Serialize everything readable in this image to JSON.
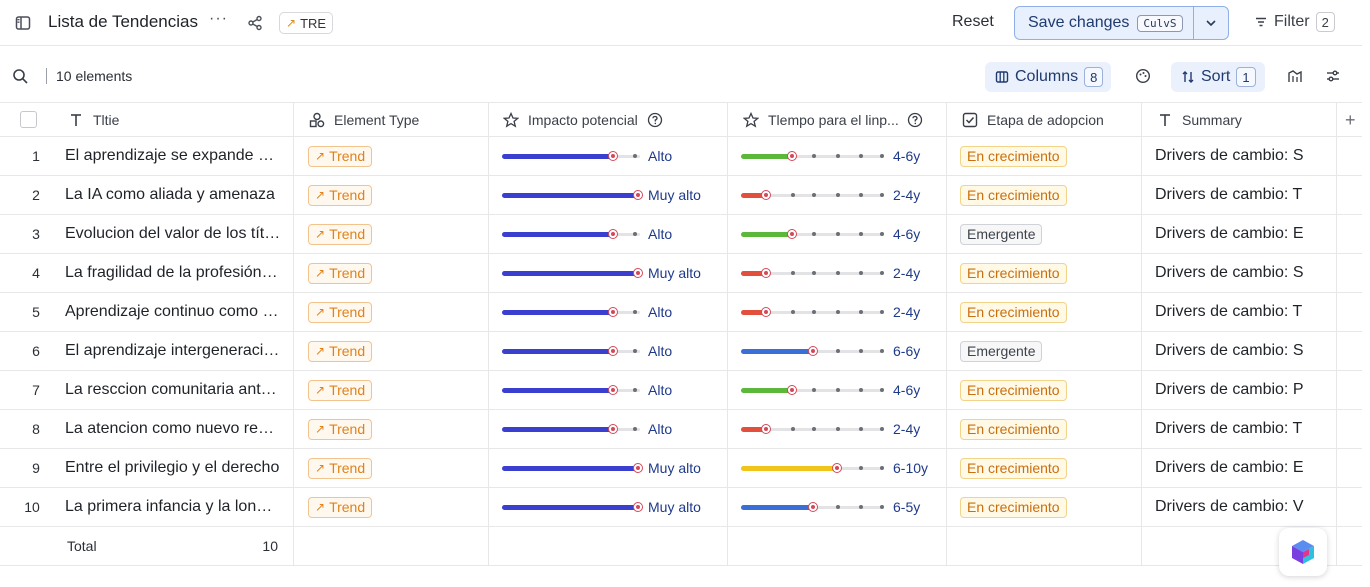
{
  "header": {
    "title": "Lista de Tendencias",
    "more_label": "···",
    "tag_label": "TRE",
    "reset_label": "Reset",
    "save_label": "Save changes",
    "save_shortcut": "CulvS",
    "filter_label": "Filter",
    "filter_count": "2"
  },
  "toolbar": {
    "elements_count": "10 elements",
    "columns_label": "Columns",
    "columns_count": "8",
    "sort_label": "Sort",
    "sort_count": "1"
  },
  "columns": {
    "title": "Tltie",
    "element_type": "Element Type",
    "impact": "Impacto potencial",
    "time": "Tlempo para el linp...",
    "stage": "Etapa de adopcion",
    "summary": "Summary"
  },
  "rows": [
    {
      "num": "1",
      "title": "El aprendizaje se expande más allá",
      "type": "Trend",
      "impact": "Alto",
      "impact_level": 0.8,
      "time": "4-6y",
      "time_level": 0.35,
      "time_color": "#5cb83a",
      "stage": "En crecimiento",
      "stage_kind": "grow",
      "summary": "Drivers de cambio: S"
    },
    {
      "num": "2",
      "title": "La IA como aliada y amenaza",
      "type": "Trend",
      "impact": "Muy alto",
      "impact_level": 0.98,
      "time": "2-4y",
      "time_level": 0.17,
      "time_color": "#e2503d",
      "stage": "En crecimiento",
      "stage_kind": "grow",
      "summary": "Drivers de cambio: T"
    },
    {
      "num": "3",
      "title": "Evolucion del valor de los títulos",
      "type": "Trend",
      "impact": "Alto",
      "impact_level": 0.8,
      "time": "4-6y",
      "time_level": 0.35,
      "time_color": "#5cb83a",
      "stage": "Emergente",
      "stage_kind": "emerg",
      "summary": "Drivers de cambio: E"
    },
    {
      "num": "4",
      "title": "La fragilidad de la profesión docente",
      "type": "Trend",
      "impact": "Muy alto",
      "impact_level": 0.98,
      "time": "2-4y",
      "time_level": 0.17,
      "time_color": "#e2503d",
      "stage": "En crecimiento",
      "stage_kind": "grow",
      "summary": "Drivers de cambio: S"
    },
    {
      "num": "5",
      "title": "Aprendizaje continuo como norma",
      "type": "Trend",
      "impact": "Alto",
      "impact_level": 0.8,
      "time": "2-4y",
      "time_level": 0.17,
      "time_color": "#e2503d",
      "stage": "En crecimiento",
      "stage_kind": "grow",
      "summary": "Drivers de cambio: T"
    },
    {
      "num": "6",
      "title": "El aprendizaje intergeneracional",
      "type": "Trend",
      "impact": "Alto",
      "impact_level": 0.8,
      "time": "6-6y",
      "time_level": 0.5,
      "time_color": "#3a6fd8",
      "stage": "Emergente",
      "stage_kind": "emerg",
      "summary": "Drivers de cambio: S"
    },
    {
      "num": "7",
      "title": "La resccion comunitaria ante la crisis",
      "type": "Trend",
      "impact": "Alto",
      "impact_level": 0.8,
      "time": "4-6y",
      "time_level": 0.35,
      "time_color": "#5cb83a",
      "stage": "En crecimiento",
      "stage_kind": "grow",
      "summary": "Drivers de cambio: P"
    },
    {
      "num": "8",
      "title": "La atencion como nuevo recurso",
      "type": "Trend",
      "impact": "Alto",
      "impact_level": 0.8,
      "time": "2-4y",
      "time_level": 0.17,
      "time_color": "#e2503d",
      "stage": "En crecimiento",
      "stage_kind": "grow",
      "summary": "Drivers de cambio: T"
    },
    {
      "num": "9",
      "title": "Entre el privilegio y el derecho",
      "type": "Trend",
      "impact": "Muy alto",
      "impact_level": 0.98,
      "time": "6-10y",
      "time_level": 0.67,
      "time_color": "#f0c419",
      "stage": "En crecimiento",
      "stage_kind": "grow",
      "summary": "Drivers de cambio: E"
    },
    {
      "num": "10",
      "title": "La primera infancia y la longevidad",
      "type": "Trend",
      "impact": "Muy alto",
      "impact_level": 0.98,
      "time": "6-5y",
      "time_level": 0.5,
      "time_color": "#3a6fd8",
      "stage": "En crecimiento",
      "stage_kind": "grow",
      "summary": "Drivers de cambio: V"
    }
  ],
  "footer": {
    "total_label": "Total",
    "total_value": "10"
  },
  "colors": {
    "impact_fill": "#3b3fd0",
    "accent": "#1f3a6e"
  }
}
